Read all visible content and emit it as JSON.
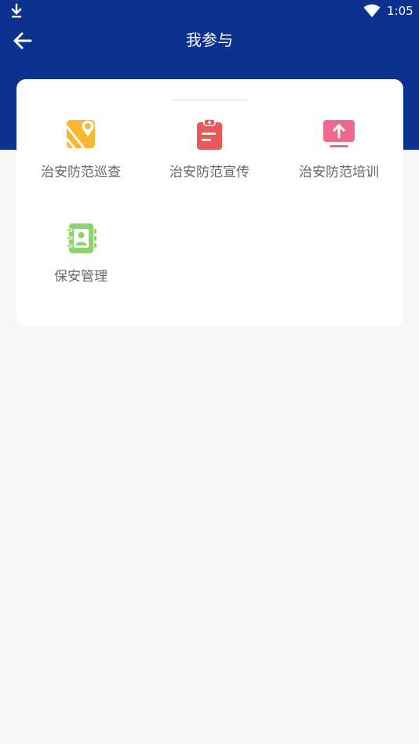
{
  "status_bar": {
    "time": "1:05",
    "download_icon": "download-icon",
    "wifi_icon": "wifi-icon"
  },
  "header": {
    "title": "我参与",
    "back_icon": "arrow-left-icon",
    "background": "#0d318f"
  },
  "menu": {
    "items": [
      {
        "label": "治安防范巡查",
        "icon": "patrol-map-icon",
        "color": "#f7b731"
      },
      {
        "label": "治安防范宣传",
        "icon": "clipboard-icon",
        "color": "#e85a5a"
      },
      {
        "label": "治安防范培训",
        "icon": "upload-screen-icon",
        "color": "#ec6a8c"
      },
      {
        "label": "保安管理",
        "icon": "contact-book-icon",
        "color": "#8fd46b"
      }
    ]
  }
}
